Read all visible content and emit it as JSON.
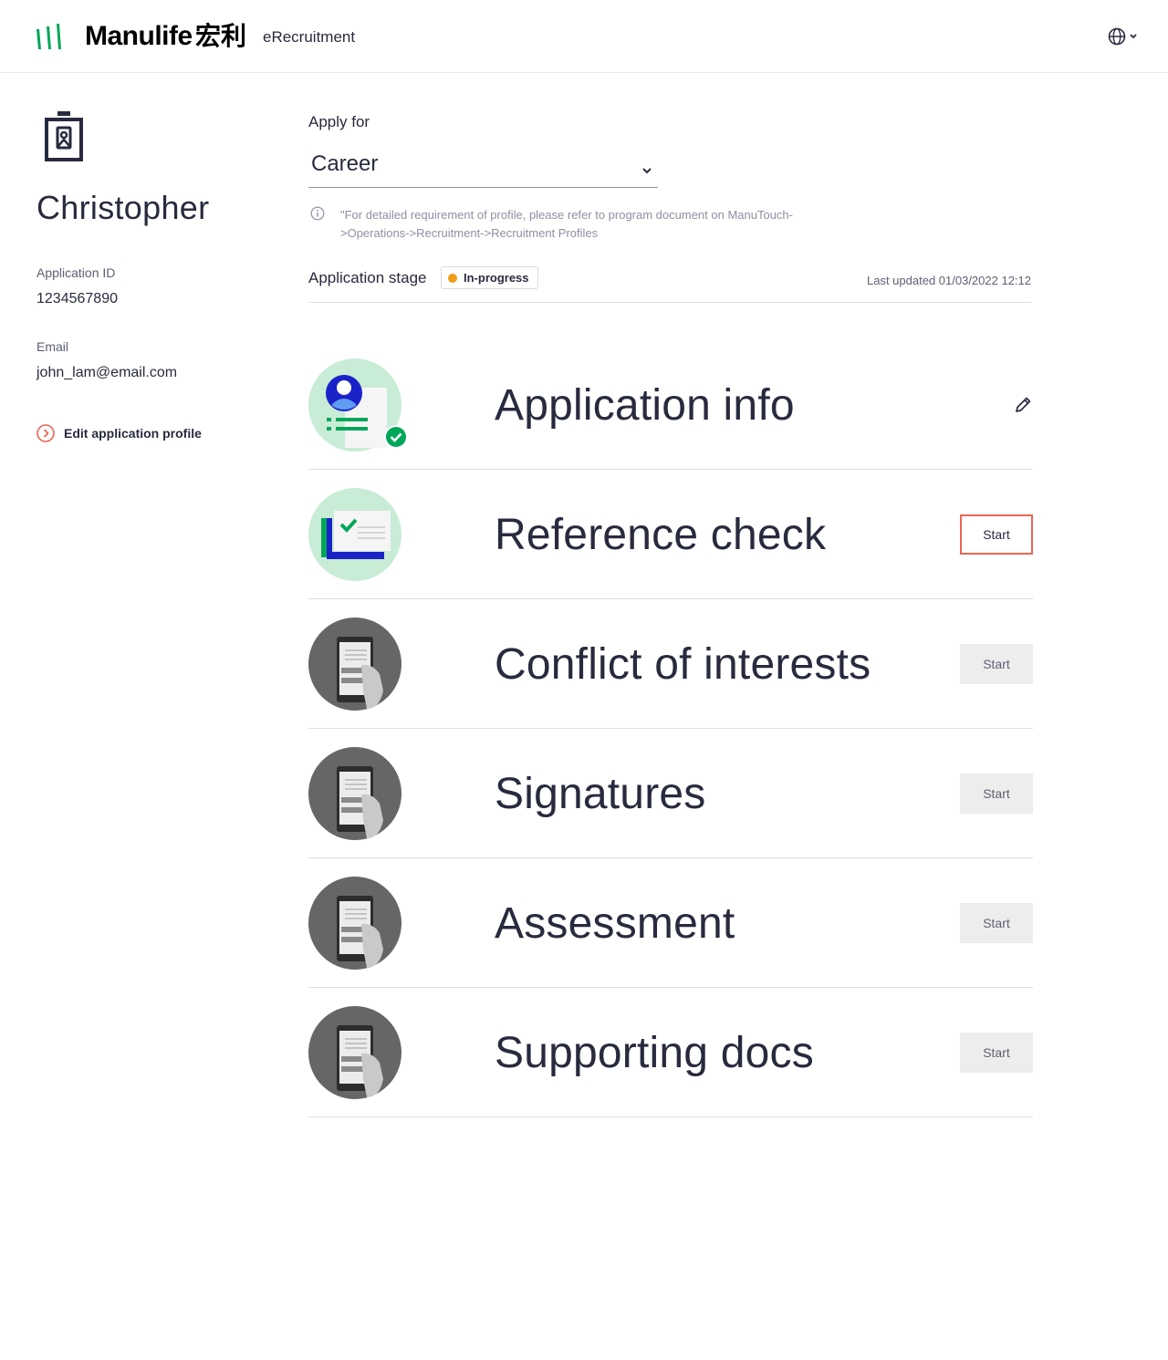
{
  "header": {
    "brand": "Manulife",
    "brand_cn": "宏利",
    "app_name": "eRecruitment",
    "language_icon": "globe-icon"
  },
  "profile": {
    "name": "Christopher",
    "application_id_label": "Application ID",
    "application_id": "1234567890",
    "email_label": "Email",
    "email": "john_lam@email.com",
    "edit_link": "Edit application profile"
  },
  "apply": {
    "label": "Apply for",
    "selected": "Career",
    "note": "\"For detailed requirement of profile, please refer to program document on ManuTouch->Operations->Recruitment->Recruitment Profiles"
  },
  "stage": {
    "label": "Application stage",
    "status": "In-progress",
    "last_updated": "Last updated 01/03/2022 12:12"
  },
  "steps": [
    {
      "title": "Application info",
      "action": "edit-icon",
      "completed": true
    },
    {
      "title": "Reference check",
      "button": "Start",
      "active": true
    },
    {
      "title": "Conflict of interests",
      "button": "Start",
      "active": false
    },
    {
      "title": "Signatures",
      "button": "Start",
      "active": false
    },
    {
      "title": "Assessment",
      "button": "Start",
      "active": false
    },
    {
      "title": "Supporting docs",
      "button": "Start",
      "active": false
    }
  ],
  "colors": {
    "brand_green": "#00a758",
    "accent_red": "#ec6453",
    "status_orange": "#f09c1a",
    "text_dark": "#282b3e"
  }
}
